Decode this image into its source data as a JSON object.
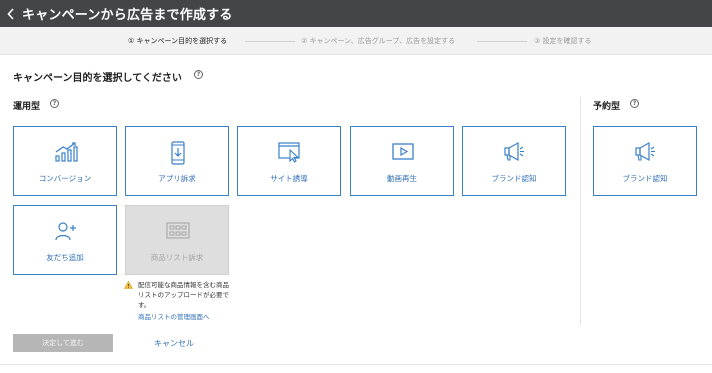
{
  "header": {
    "back_icon": "chevron-left-icon",
    "title": "キャンペーンから広告まで作成する"
  },
  "steps": [
    {
      "label": "① キャンペーン目的を選択する",
      "state": "active"
    },
    {
      "label": "② キャンペーン、広告グループ、広告を設定する",
      "state": "inactive"
    },
    {
      "label": "③ 設定を確認する",
      "state": "inactive"
    }
  ],
  "main": {
    "heading": "キャンペーン目的を選択してください",
    "help": "?",
    "operational": {
      "heading": "運用型",
      "help": "?",
      "cards": [
        {
          "label": "コンバージョン",
          "icon": "chart-growth-icon"
        },
        {
          "label": "アプリ訴求",
          "icon": "smartphone-download-icon"
        },
        {
          "label": "サイト誘導",
          "icon": "browser-cursor-icon"
        },
        {
          "label": "動画再生",
          "icon": "play-icon"
        },
        {
          "label": "ブランド認知",
          "icon": "megaphone-icon"
        },
        {
          "label": "友だち追加",
          "icon": "add-user-icon"
        },
        {
          "label": "商品リスト訴求",
          "icon": "product-grid-icon",
          "disabled": true
        }
      ]
    },
    "reserved": {
      "heading": "予約型",
      "help": "?",
      "cards": [
        {
          "label": "ブランド認知",
          "icon": "megaphone-icon"
        }
      ]
    },
    "warning": {
      "icon": "warning-icon",
      "text": "配信可能な商品情報を含む商品リストのアップロードが必要です。",
      "link": "商品リストの管理画面へ"
    }
  },
  "footer": {
    "submit_label": "決定して進む",
    "cancel_label": "キャンセル"
  },
  "colors": {
    "accent": "#3a80c8",
    "header_bg": "#444547",
    "disabled_bg": "#dedede",
    "warning": "#e6a100"
  }
}
